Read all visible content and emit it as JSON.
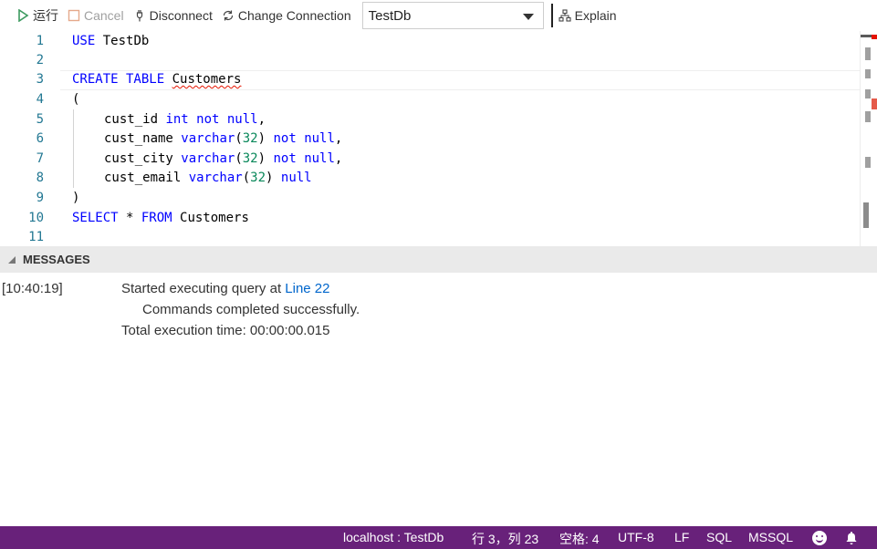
{
  "toolbar": {
    "run_label": "运行",
    "cancel_label": "Cancel",
    "disconnect_label": "Disconnect",
    "change_connection_label": "Change Connection",
    "database_selected": "TestDb",
    "explain_label": "Explain"
  },
  "editor": {
    "line_numbers": [
      "1",
      "2",
      "3",
      "4",
      "5",
      "6",
      "7",
      "8",
      "9",
      "10",
      "11"
    ],
    "lines": {
      "l1_kw": "USE",
      "l1_id": " TestDb",
      "l3_kw": "CREATE TABLE",
      "l3_id": "Customers",
      "l4": "(",
      "l5_id": "cust_id ",
      "l5_type": "int",
      "l5_rest_kw": " not null",
      "l5_end": ",",
      "l6_id": "cust_name ",
      "l6_type": "varchar",
      "l6_open": "(",
      "l6_num": "32",
      "l6_close": ")",
      "l6_kw": " not null",
      "l6_end": ",",
      "l7_id": "cust_city ",
      "l7_type": "varchar",
      "l7_open": "(",
      "l7_num": "32",
      "l7_close": ")",
      "l7_kw": " not null",
      "l7_end": ",",
      "l8_id": "cust_email ",
      "l8_type": "varchar",
      "l8_open": "(",
      "l8_num": "32",
      "l8_close": ")",
      "l8_kw": " null",
      "l9": ")",
      "l10_kw1": "SELECT",
      "l10_star": " * ",
      "l10_kw2": "FROM",
      "l10_id": " Customers"
    }
  },
  "messages": {
    "header": "MESSAGES",
    "timestamp": "[10:40:19]",
    "line1_prefix": "Started executing query at ",
    "line1_link": "Line 22",
    "line2": "Commands completed successfully.",
    "line3": "Total execution time: 00:00:00.015"
  },
  "statusbar": {
    "connection": "localhost : TestDb",
    "position": "行 3，列 23",
    "spaces": "空格: 4",
    "encoding": "UTF-8",
    "eol": "LF",
    "language": "SQL",
    "provider": "MSSQL"
  },
  "colors": {
    "statusbar_bg": "#68217a",
    "keyword": "#0000ff",
    "number": "#09885a",
    "line_number": "#237893",
    "link": "#0066cc",
    "run_icon": "#3c9a5f",
    "error_squiggle": "#e51400"
  },
  "icons": [
    "run-icon",
    "cancel-icon",
    "disconnect-icon",
    "change-connection-icon",
    "explain-icon",
    "feedback-smiley-icon",
    "notification-bell-icon"
  ]
}
